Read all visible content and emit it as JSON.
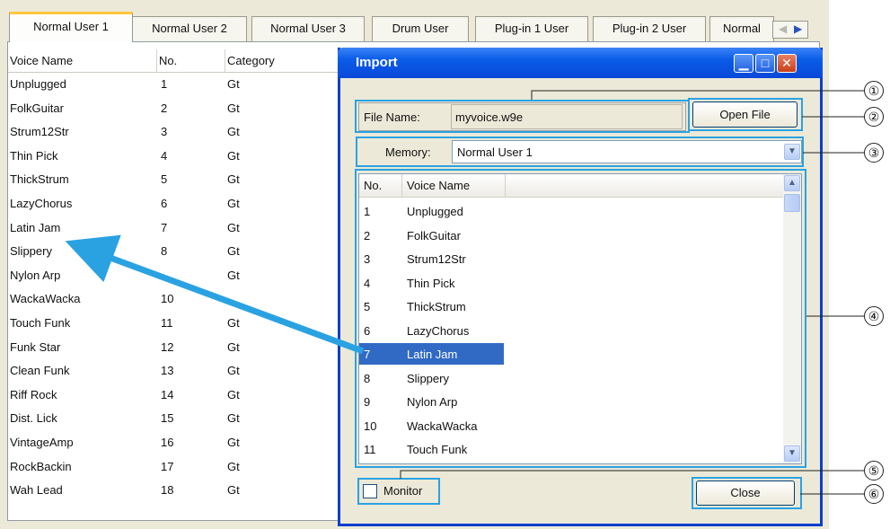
{
  "tabs": [
    "Normal User 1",
    "Normal User 2",
    "Normal User 3",
    "Drum User",
    "Plug-in 1 User",
    "Plug-in 2 User",
    "Normal"
  ],
  "active_tab": "Normal User 1",
  "voice_list": {
    "columns": [
      "Voice Name",
      "No.",
      "Category"
    ],
    "rows": [
      {
        "name": "Unplugged",
        "no": "1",
        "cat": "Gt"
      },
      {
        "name": "FolkGuitar",
        "no": "2",
        "cat": "Gt"
      },
      {
        "name": "Strum12Str",
        "no": "3",
        "cat": "Gt"
      },
      {
        "name": "Thin Pick",
        "no": "4",
        "cat": "Gt"
      },
      {
        "name": "ThickStrum",
        "no": "5",
        "cat": "Gt"
      },
      {
        "name": "LazyChorus",
        "no": "6",
        "cat": "Gt"
      },
      {
        "name": "Latin Jam",
        "no": "7",
        "cat": "Gt"
      },
      {
        "name": "Slippery",
        "no": "8",
        "cat": "Gt"
      },
      {
        "name": "Nylon Arp",
        "no": "",
        "cat": "Gt"
      },
      {
        "name": "WackaWacka",
        "no": "10",
        "cat": ""
      },
      {
        "name": "Touch Funk",
        "no": "11",
        "cat": "Gt"
      },
      {
        "name": "Funk Star",
        "no": "12",
        "cat": "Gt"
      },
      {
        "name": "Clean Funk",
        "no": "13",
        "cat": "Gt"
      },
      {
        "name": "Riff Rock",
        "no": "14",
        "cat": "Gt"
      },
      {
        "name": "Dist. Lick",
        "no": "15",
        "cat": "Gt"
      },
      {
        "name": "VintageAmp",
        "no": "16",
        "cat": "Gt"
      },
      {
        "name": "RockBackin",
        "no": "17",
        "cat": "Gt"
      },
      {
        "name": "Wah Lead",
        "no": "18",
        "cat": "Gt"
      }
    ]
  },
  "dialog": {
    "title": "Import",
    "file_name_label": "File Name:",
    "file_name_value": "myvoice.w9e",
    "open_file_label": "Open File",
    "memory_label": "Memory:",
    "memory_value": "Normal User 1",
    "list_columns": [
      "No.",
      "Voice Name"
    ],
    "list_rows": [
      {
        "no": "1",
        "name": "Unplugged"
      },
      {
        "no": "2",
        "name": "FolkGuitar"
      },
      {
        "no": "3",
        "name": "Strum12Str"
      },
      {
        "no": "4",
        "name": "Thin Pick"
      },
      {
        "no": "5",
        "name": "ThickStrum"
      },
      {
        "no": "6",
        "name": "LazyChorus"
      },
      {
        "no": "7",
        "name": "Latin Jam"
      },
      {
        "no": "8",
        "name": "Slippery"
      },
      {
        "no": "9",
        "name": "Nylon Arp"
      },
      {
        "no": "10",
        "name": "WackaWacka"
      },
      {
        "no": "11",
        "name": "Touch Funk"
      }
    ],
    "selected_row": 6,
    "monitor_label": "Monitor",
    "monitor_checked": false,
    "close_label": "Close"
  },
  "callouts": [
    "①",
    "②",
    "③",
    "④",
    "⑤",
    "⑥"
  ],
  "colors": {
    "highlight_box": "#2aa2e2",
    "arrow": "#2aa2e2",
    "selection": "#316ac5",
    "titlebar": "#0a5ce8"
  }
}
